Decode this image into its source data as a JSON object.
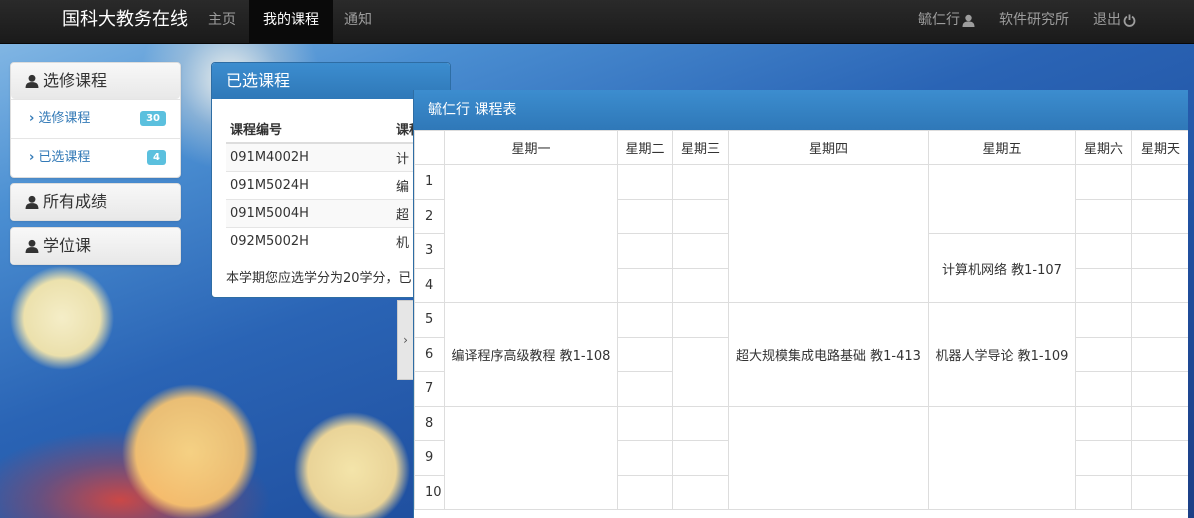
{
  "navbar": {
    "brand": "国科大教务在线",
    "items": [
      {
        "label": "主页",
        "active": false
      },
      {
        "label": "我的课程",
        "active": true
      },
      {
        "label": "通知",
        "active": false
      }
    ],
    "user": "毓仁行",
    "institute": "软件研究所",
    "logout": "退出"
  },
  "sidebar": {
    "elective": {
      "title": "选修课程",
      "links": [
        {
          "label": "选修课程",
          "count": "30"
        },
        {
          "label": "已选课程",
          "count": "4"
        }
      ]
    },
    "grades_title": "所有成绩",
    "degree_title": "学位课"
  },
  "selected_panel": {
    "title": "已选课程",
    "columns": [
      "课程编号",
      "课程"
    ],
    "rows": [
      [
        "091M4002H",
        "计"
      ],
      [
        "091M5024H",
        "编"
      ],
      [
        "091M5004H",
        "超"
      ],
      [
        "092M5002H",
        "机"
      ]
    ],
    "summary": "本学期您应选学分为20学分，已"
  },
  "timetable": {
    "title": "毓仁行 课程表",
    "days": [
      "星期一",
      "星期二",
      "星期三",
      "星期四",
      "星期五",
      "星期六",
      "星期天"
    ],
    "periods": [
      "1",
      "2",
      "3",
      "4",
      "5",
      "6",
      "7",
      "8",
      "9",
      "10"
    ],
    "courses": {
      "mon": "编译程序高级教程 教1-108",
      "thu": "超大规模集成电路基础 教1-413",
      "fri_a": "计算机网络 教1-107",
      "fri_b": "机器人学导论 教1-109"
    }
  },
  "colors": {
    "navbar": "#222222",
    "panel_header": "#337ab7",
    "badge": "#5bc0de",
    "link": "#337ab7"
  },
  "icons": {
    "user": "user-icon",
    "power": "power-icon",
    "chevron": "chevron-right-icon"
  }
}
